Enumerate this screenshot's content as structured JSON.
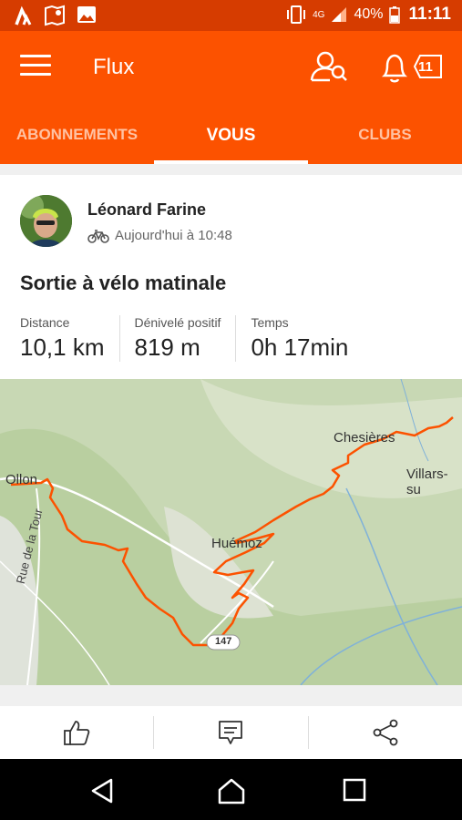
{
  "status": {
    "battery": "40%",
    "time": "11:11",
    "network": "4G"
  },
  "header": {
    "title": "Flux",
    "notification_count": "11"
  },
  "tabs": [
    {
      "label": "ABONNEMENTS"
    },
    {
      "label": "VOUS"
    },
    {
      "label": "CLUBS"
    }
  ],
  "activity": {
    "user": "Léonard Farine",
    "time": "Aujourd'hui à 10:48",
    "title": "Sortie à vélo matinale",
    "stats": [
      {
        "label": "Distance",
        "value": "10,1 km"
      },
      {
        "label": "Dénivelé positif",
        "value": "819 m"
      },
      {
        "label": "Temps",
        "value": "0h 17min"
      }
    ]
  },
  "map": {
    "places": {
      "ollon": "Ollon",
      "chesieres": "Chesières",
      "villars": "Villars-su",
      "huemoz": "Huémoz",
      "road": "Rue de la Tour",
      "route_number": "147"
    },
    "route_color": "#fc5200"
  },
  "icons": {
    "menu": "menu-icon",
    "person_search": "find-friends-icon",
    "bell": "bell-icon",
    "like": "thumbs-up-icon",
    "comment": "comment-icon",
    "share": "share-icon",
    "bike": "bike-icon"
  }
}
